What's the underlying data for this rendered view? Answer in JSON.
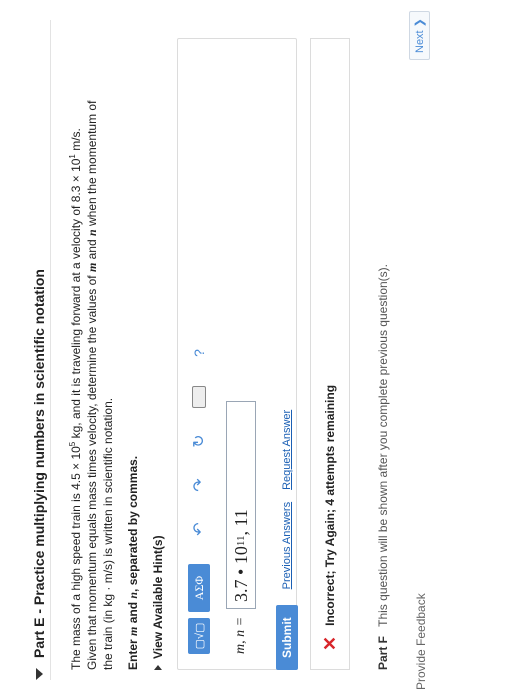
{
  "part_e": {
    "title": "Part E - Practice multiplying numbers in scientific notation",
    "problem": {
      "line1_a": "The mass of a high speed train is 4.5 × 10",
      "line1_exp": "5",
      "line1_b": " kg, and it is traveling forward at a velocity of 8.3 × 10",
      "line1_exp2": "1",
      "line1_c": " m/s.",
      "line2_a": "Given that momentum equals mass times velocity, determine the values of ",
      "line2_m": "m",
      "line2_mid": " and ",
      "line2_n": "n",
      "line2_b": " when the momentum of",
      "line3": "the train (in kg · m/s) is written in scientific notation."
    },
    "enter_a": "Enter ",
    "enter_m": "m",
    "enter_mid": " and ",
    "enter_n": "n",
    "enter_b": ", separated by commas.",
    "hints_label": "View Available Hint(s)",
    "toolbar": {
      "template_label": "▢√▢",
      "greek_label": "ΑΣΦ",
      "undo": "↶",
      "redo": "↷",
      "reset": "↻",
      "help": "?"
    },
    "entry_label": "m, n =",
    "entry_value_a": "3.7 • 10",
    "entry_value_exp": "11",
    "entry_value_b": " , 11",
    "submit": "Submit",
    "previous_answers": "Previous Answers",
    "request_answer": "Request Answer",
    "feedback": "Incorrect; Try Again; 4 attempts remaining"
  },
  "part_f": {
    "label": "Part F",
    "text": "This question will be shown after you complete previous question(s)."
  },
  "provide_feedback": "Provide Feedback",
  "next": "Next ❯"
}
